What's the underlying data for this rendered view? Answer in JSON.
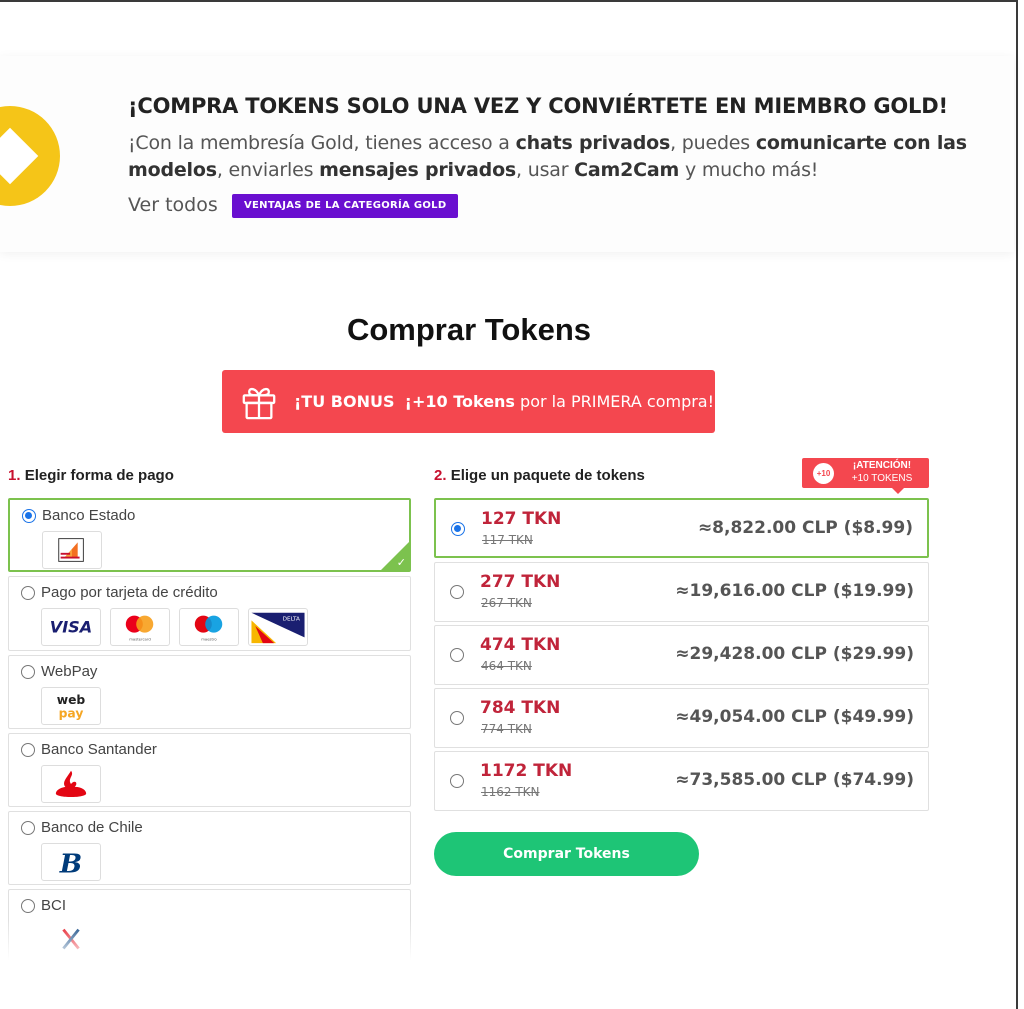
{
  "gold": {
    "title": "¡COMPRA TOKENS SOLO UNA VEZ Y CONVIÉRTETE EN MIEMBRO GOLD!",
    "text_parts": [
      "¡Con la membresía Gold, tienes acceso a ",
      "chats privados",
      ", puedes ",
      "comunicarte con las modelos",
      ", enviarles ",
      "mensajes privados",
      ", usar ",
      "Cam2Cam",
      " y mucho más!"
    ],
    "see_all": "Ver todos",
    "button": "VENTAJAS DE LA CATEGORÍA GOLD",
    "accent": "#f5c518"
  },
  "page_title": "Comprar Tokens",
  "bonus": {
    "lead": "¡TU BONUS",
    "amount": "¡+10 Tokens",
    "rest": "por la PRIMERA compra!",
    "icon": "gift-icon",
    "color": "#f4474f"
  },
  "payment": {
    "section_num": "1.",
    "section_title": "Elegir forma de pago",
    "methods": [
      {
        "label": "Banco Estado",
        "selected": true
      },
      {
        "label": "Pago por tarjeta de crédito",
        "selected": false,
        "logos": [
          "VISA",
          "mastercard",
          "maestro",
          "DELTA"
        ]
      },
      {
        "label": "WebPay",
        "selected": false,
        "logo_text": [
          "web",
          "pay"
        ]
      },
      {
        "label": "Banco Santander",
        "selected": false
      },
      {
        "label": "Banco de Chile",
        "selected": false
      },
      {
        "label": "BCI",
        "selected": false
      }
    ]
  },
  "packages": {
    "section_num": "2.",
    "section_title": "Elige un paquete de tokens",
    "attention": {
      "badge": "+10",
      "line1": "¡ATENCIÓN!",
      "line2": "+10 TOKENS"
    },
    "items": [
      {
        "tokens": "127 TKN",
        "old": "117 TKN",
        "price": "≈8,822.00 CLP ($8.99)",
        "selected": true
      },
      {
        "tokens": "277 TKN",
        "old": "267 TKN",
        "price": "≈19,616.00 CLP ($19.99)",
        "selected": false
      },
      {
        "tokens": "474 TKN",
        "old": "464 TKN",
        "price": "≈29,428.00 CLP ($29.99)",
        "selected": false
      },
      {
        "tokens": "784 TKN",
        "old": "774 TKN",
        "price": "≈49,054.00 CLP ($49.99)",
        "selected": false
      },
      {
        "tokens": "1172 TKN",
        "old": "1162 TKN",
        "price": "≈73,585.00 CLP ($74.99)",
        "selected": false
      }
    ]
  },
  "buy_button": "Comprar Tokens",
  "colors": {
    "selected_border": "#7cc24e",
    "token_red": "#c0243a",
    "buy_green": "#1ec576",
    "gold_purple": "#6a0fd0"
  }
}
